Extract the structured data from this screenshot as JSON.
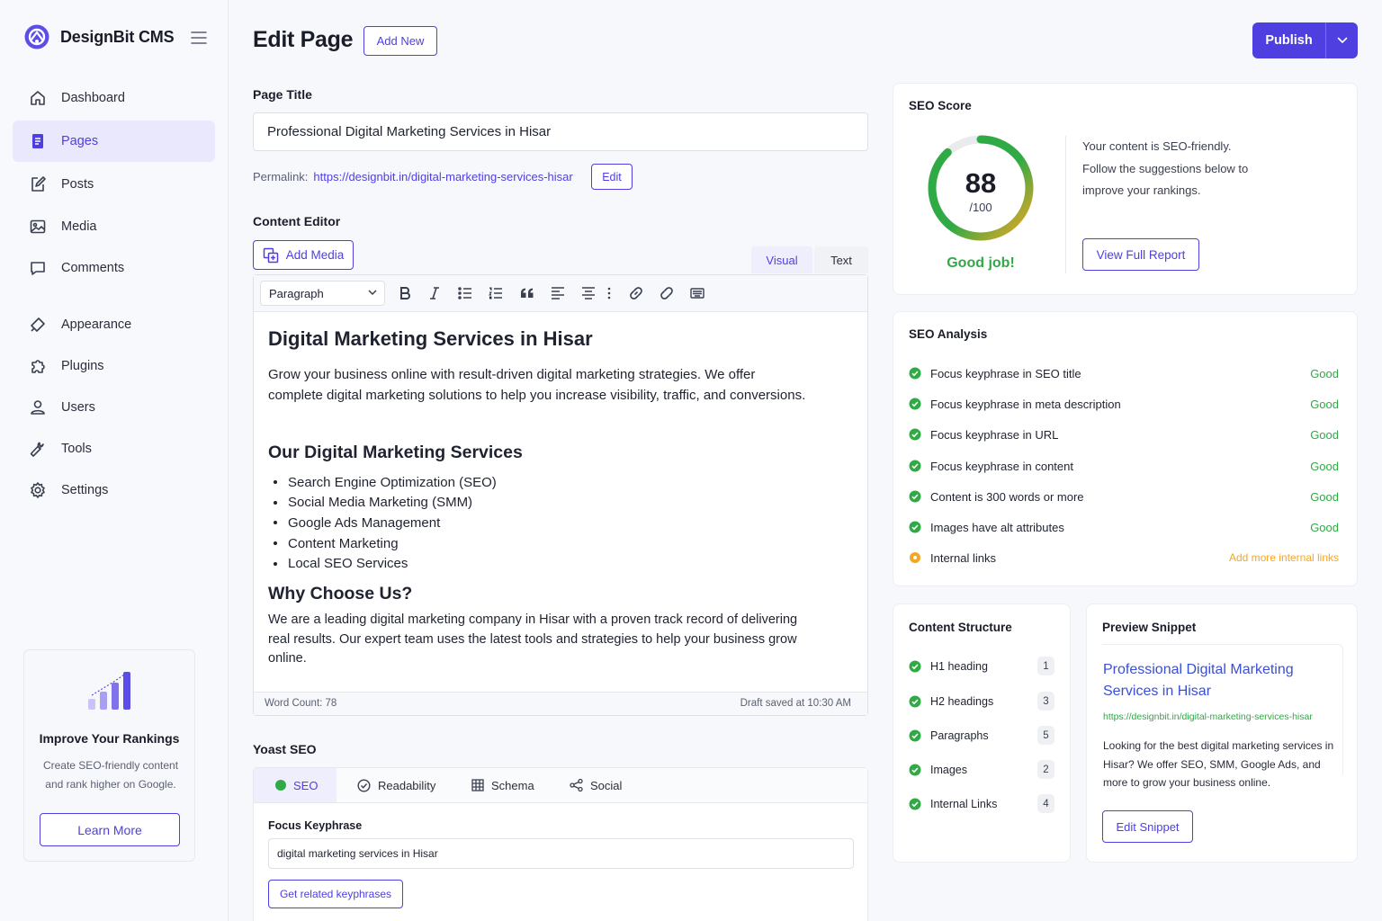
{
  "app": {
    "name": "DesignBit CMS"
  },
  "nav": {
    "items": [
      {
        "label": "Dashboard",
        "icon": "home-icon"
      },
      {
        "label": "Pages",
        "icon": "document-icon",
        "active": true
      },
      {
        "label": "Posts",
        "icon": "edit-icon"
      },
      {
        "label": "Media",
        "icon": "image-icon"
      },
      {
        "label": "Comments",
        "icon": "comment-icon"
      },
      {
        "label": "Appearance",
        "icon": "brush-icon"
      },
      {
        "label": "Plugins",
        "icon": "puzzle-icon"
      },
      {
        "label": "Users",
        "icon": "user-icon"
      },
      {
        "label": "Tools",
        "icon": "wrench-icon"
      },
      {
        "label": "Settings",
        "icon": "gear-icon"
      }
    ]
  },
  "promo": {
    "title": "Improve Your Rankings",
    "text": "Create SEO-friendly content and rank higher on Google.",
    "button": "Learn More"
  },
  "header": {
    "title": "Edit Page",
    "add_new": "Add New",
    "publish": "Publish"
  },
  "page_title": {
    "label": "Page Title",
    "value": "Professional Digital Marketing Services in Hisar"
  },
  "permalink": {
    "label": "Permalink:",
    "url": "https://designbit.in/digital-marketing-services-hisar",
    "edit": "Edit"
  },
  "editor": {
    "label": "Content Editor",
    "add_media": "Add Media",
    "tabs": [
      "Visual",
      "Text"
    ],
    "active_tab": "Visual",
    "format": "Paragraph",
    "h1": "Digital Marketing Services in Hisar",
    "p1": "Grow your business online with result-driven digital marketing strategies. We offer complete digital marketing solutions to help you increase visibility, traffic, and conversions.",
    "h2a": "Our Digital Marketing Services",
    "services": [
      "Search Engine Optimization (SEO)",
      "Social Media Marketing (SMM)",
      "Google Ads Management",
      "Content Marketing",
      "Local SEO Services"
    ],
    "h2b": "Why Choose Us?",
    "p2": "We are a leading digital marketing company in Hisar with a proven track record of delivering real results. Our expert team uses the latest tools and strategies to help your business grow online.",
    "word_count": "Word Count: 78",
    "draft_saved": "Draft saved at 10:30 AM"
  },
  "yoast": {
    "label": "Yoast SEO",
    "tabs": [
      "SEO",
      "Readability",
      "Schema",
      "Social"
    ],
    "active_tab": "SEO",
    "focus_label": "Focus Keyphrase",
    "focus_value": "digital marketing services in Hisar",
    "related_button": "Get related keyphrases"
  },
  "seo_score": {
    "title": "SEO Score",
    "score": "88",
    "max": "/100",
    "score_value": 88,
    "verdict": "Good job!",
    "message": "Your content is SEO-friendly. Follow the suggestions below to improve your rankings.",
    "button": "View Full Report"
  },
  "seo_analysis": {
    "title": "SEO Analysis",
    "items": [
      {
        "label": "Focus keyphrase in SEO title",
        "status": "Good",
        "state": "good"
      },
      {
        "label": "Focus keyphrase in meta description",
        "status": "Good",
        "state": "good"
      },
      {
        "label": "Focus keyphrase in URL",
        "status": "Good",
        "state": "good"
      },
      {
        "label": "Focus keyphrase in content",
        "status": "Good",
        "state": "good"
      },
      {
        "label": "Content is 300 words or more",
        "status": "Good",
        "state": "good"
      },
      {
        "label": "Images have alt attributes",
        "status": "Good",
        "state": "good"
      },
      {
        "label": "Internal links",
        "status": "Add more internal links",
        "state": "warn"
      }
    ]
  },
  "structure": {
    "title": "Content Structure",
    "items": [
      {
        "label": "H1 heading",
        "count": "1"
      },
      {
        "label": "H2 headings",
        "count": "3"
      },
      {
        "label": "Paragraphs",
        "count": "5"
      },
      {
        "label": "Images",
        "count": "2"
      },
      {
        "label": "Internal Links",
        "count": "4"
      }
    ]
  },
  "snippet": {
    "title": "Preview Snippet",
    "headline": "Professional Digital Marketing Services in Hisar",
    "url": "https://designbit.in/digital-marketing-services-hisar",
    "description": "Looking for the best digital marketing services in Hisar? We offer SEO, SMM, Google Ads, and more to grow your business online.",
    "button": "Edit Snippet"
  },
  "colors": {
    "accent": "#4f3fe0",
    "good": "#2faa45",
    "warn": "#f5a623"
  }
}
